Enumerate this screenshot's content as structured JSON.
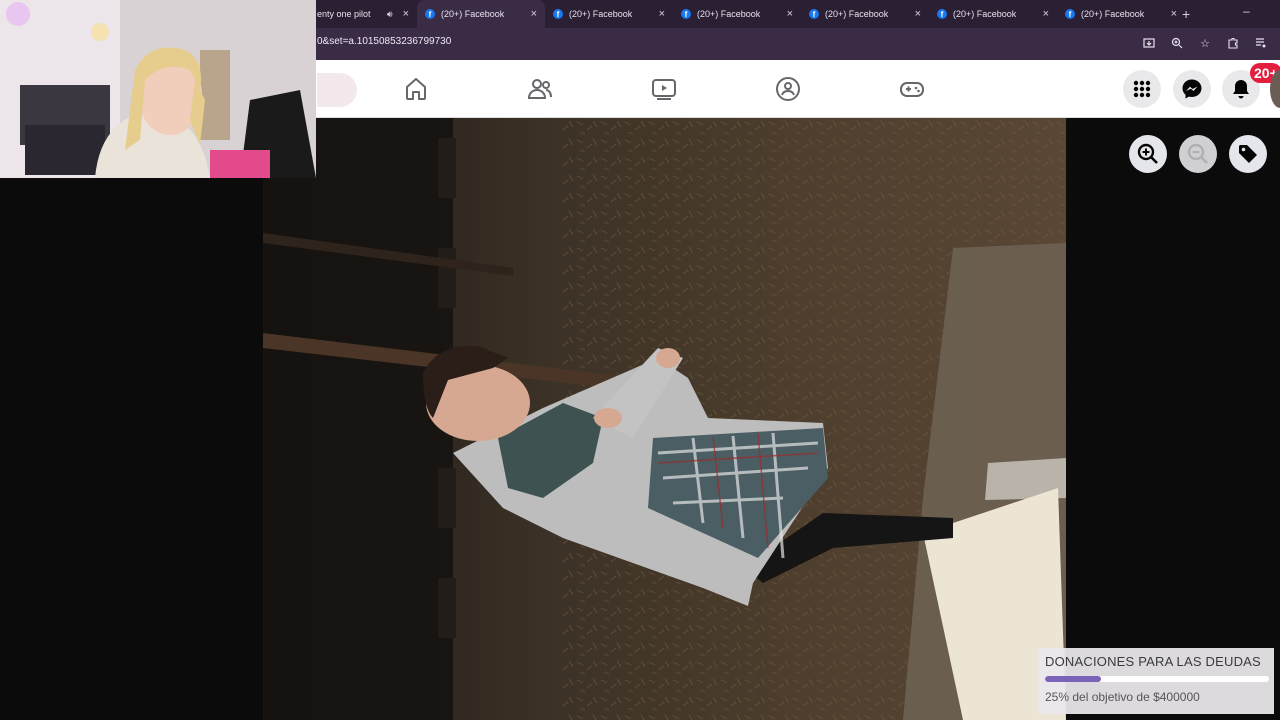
{
  "browser": {
    "tabs": [
      {
        "title": "enty one pilot",
        "audio": true,
        "active": false
      },
      {
        "title": "(20+) Facebook",
        "active": true
      },
      {
        "title": "(20+) Facebook",
        "active": false
      },
      {
        "title": "(20+) Facebook",
        "active": false
      },
      {
        "title": "(20+) Facebook",
        "active": false
      },
      {
        "title": "(20+) Facebook",
        "active": false
      },
      {
        "title": "(20+) Facebook",
        "active": false
      }
    ],
    "url": "0&set=a.10150853236799730",
    "new_tab_symbol": "+",
    "minimize_symbol": "–",
    "close_symbol": "×"
  },
  "facebook": {
    "nav_icons": [
      "home-icon",
      "friends-icon",
      "watch-icon",
      "groups-icon",
      "gaming-icon"
    ],
    "right_icons": [
      "menu-grid-icon",
      "messenger-icon",
      "notifications-icon"
    ],
    "notification_badge": "20+",
    "brand_color": "#1877f2",
    "badge_color": "#e41e3f"
  },
  "viewer": {
    "controls": [
      "zoom-in-icon",
      "zoom-out-icon",
      "tag-icon"
    ],
    "zoom_out_enabled": false
  },
  "donation": {
    "title": "DONACIONES PARA LAS DEUDAS",
    "progress_fraction": 0.25,
    "subtitle": "25% del objetivo de $400000",
    "bar_color": "#7a63b8"
  }
}
